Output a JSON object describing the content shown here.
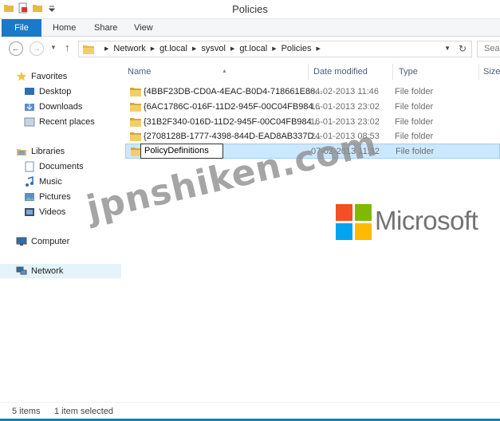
{
  "window": {
    "title": "Policies"
  },
  "ribbon": {
    "tabs": [
      "File",
      "Home",
      "Share",
      "View"
    ]
  },
  "address": {
    "crumbs": [
      "Network",
      "gt.local",
      "sysvol",
      "gt.local",
      "Policies"
    ],
    "search_placeholder": "Sear"
  },
  "nav_pane": {
    "favorites": {
      "label": "Favorites",
      "items": [
        "Desktop",
        "Downloads",
        "Recent places"
      ]
    },
    "libraries": {
      "label": "Libraries",
      "items": [
        "Documents",
        "Music",
        "Pictures",
        "Videos"
      ]
    },
    "computer": "Computer",
    "network": "Network"
  },
  "columns": {
    "name": "Name",
    "date_modified": "Date modified",
    "type": "Type",
    "size": "Size"
  },
  "files": [
    {
      "name": "{4BBF23DB-CD0A-4EAC-B0D4-718661E88...",
      "date": "04-02-2013 11:46",
      "type": "File folder"
    },
    {
      "name": "{6AC1786C-016F-11D2-945F-00C04FB984...",
      "date": "16-01-2013 23:02",
      "type": "File folder"
    },
    {
      "name": "{31B2F340-016D-11D2-945F-00C04FB984...",
      "date": "16-01-2013 23:02",
      "type": "File folder"
    },
    {
      "name": "{2708128B-1777-4398-844D-EAD8AB337D...",
      "date": "24-01-2013 08:53",
      "type": "File folder"
    },
    {
      "name": "PolicyDefinitions",
      "date": "07-02-2013 11:32",
      "type": "File folder"
    }
  ],
  "branding": {
    "logo_text": "Microsoft",
    "watermark": "jpnshiken.com",
    "logo_colors": [
      "#f25022",
      "#7fba00",
      "#00a4ef",
      "#ffb900"
    ]
  },
  "status": {
    "item_count": "5 items",
    "selection": "1 item selected"
  },
  "colors": {
    "accent": "#1979ca",
    "selection": "#cce8ff",
    "folder": "#e8b84a"
  },
  "icons": {
    "back": "back-arrow-icon",
    "forward": "forward-arrow-icon",
    "up": "up-arrow-icon",
    "refresh": "refresh-icon",
    "folder": "folder-icon"
  }
}
